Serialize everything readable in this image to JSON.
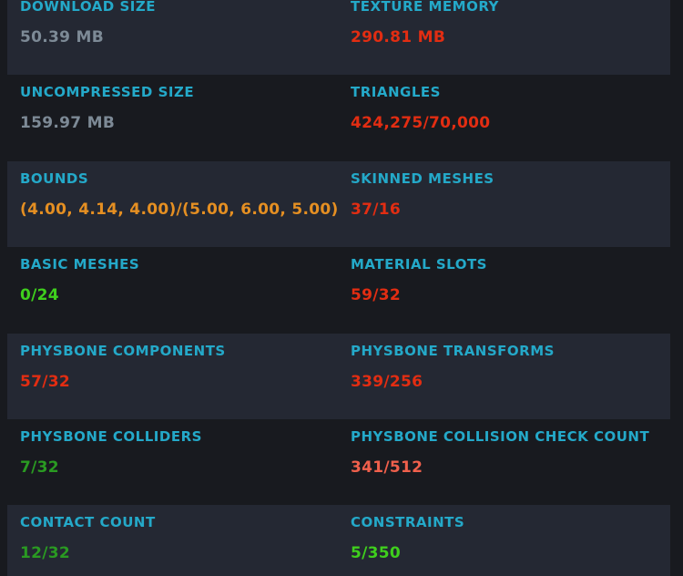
{
  "colors": {
    "label": "#24a9c9",
    "row_striped_bg": "#242833",
    "row_bg": "#181a1f",
    "value_gray": "#7d8a96",
    "value_red": "#e22d12",
    "value_orange": "#e58f22",
    "value_green": "#3fcf1d",
    "value_darkgreen": "#2a9a22",
    "value_salmon": "#f0604c"
  },
  "stats": {
    "download_size": {
      "label": "DOWNLOAD SIZE",
      "value": "50.39 MB"
    },
    "texture_memory": {
      "label": "TEXTURE MEMORY",
      "value": "290.81 MB"
    },
    "uncompressed_size": {
      "label": "UNCOMPRESSED SIZE",
      "value": "159.97 MB"
    },
    "triangles": {
      "label": "TRIANGLES",
      "value": "424,275/70,000"
    },
    "bounds": {
      "label": "BOUNDS",
      "value": "(4.00, 4.14, 4.00)/(5.00, 6.00, 5.00)"
    },
    "skinned_meshes": {
      "label": "SKINNED MESHES",
      "value": "37/16"
    },
    "basic_meshes": {
      "label": "BASIC MESHES",
      "value": "0/24"
    },
    "material_slots": {
      "label": "MATERIAL SLOTS",
      "value": "59/32"
    },
    "physbone_components": {
      "label": "PHYSBONE COMPONENTS",
      "value": "57/32"
    },
    "physbone_transforms": {
      "label": "PHYSBONE TRANSFORMS",
      "value": "339/256"
    },
    "physbone_colliders": {
      "label": "PHYSBONE COLLIDERS",
      "value": "7/32"
    },
    "physbone_collision_check_count": {
      "label": "PHYSBONE COLLISION CHECK COUNT",
      "value": "341/512"
    },
    "contact_count": {
      "label": "CONTACT COUNT",
      "value": "12/32"
    },
    "constraints": {
      "label": "CONSTRAINTS",
      "value": "5/350"
    }
  }
}
